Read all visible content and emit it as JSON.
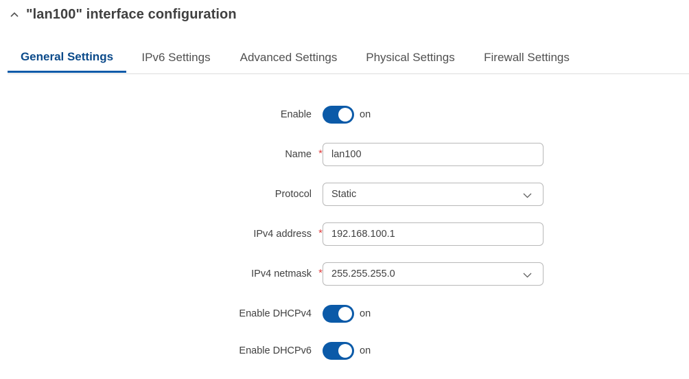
{
  "header": {
    "title": "\"lan100\" interface configuration",
    "collapse_icon": "chevron-up-icon"
  },
  "tabs": [
    {
      "label": "General Settings",
      "active": true
    },
    {
      "label": "IPv6 Settings",
      "active": false
    },
    {
      "label": "Advanced Settings",
      "active": false
    },
    {
      "label": "Physical Settings",
      "active": false
    },
    {
      "label": "Firewall Settings",
      "active": false
    }
  ],
  "form": {
    "enable": {
      "label": "Enable",
      "state": "on"
    },
    "name": {
      "label": "Name",
      "value": "lan100",
      "required": true
    },
    "protocol": {
      "label": "Protocol",
      "value": "Static"
    },
    "ipv4_address": {
      "label": "IPv4 address",
      "value": "192.168.100.1",
      "required": true
    },
    "ipv4_netmask": {
      "label": "IPv4 netmask",
      "value": "255.255.255.0",
      "required": true
    },
    "enable_dhcpv4": {
      "label": "Enable DHCPv4",
      "state": "on"
    },
    "enable_dhcpv6": {
      "label": "Enable DHCPv6",
      "state": "on"
    }
  },
  "required_marker": "*",
  "colors": {
    "accent": "#0b5aa8",
    "active_tab_text": "#0b4a8a",
    "required": "#e04040"
  }
}
